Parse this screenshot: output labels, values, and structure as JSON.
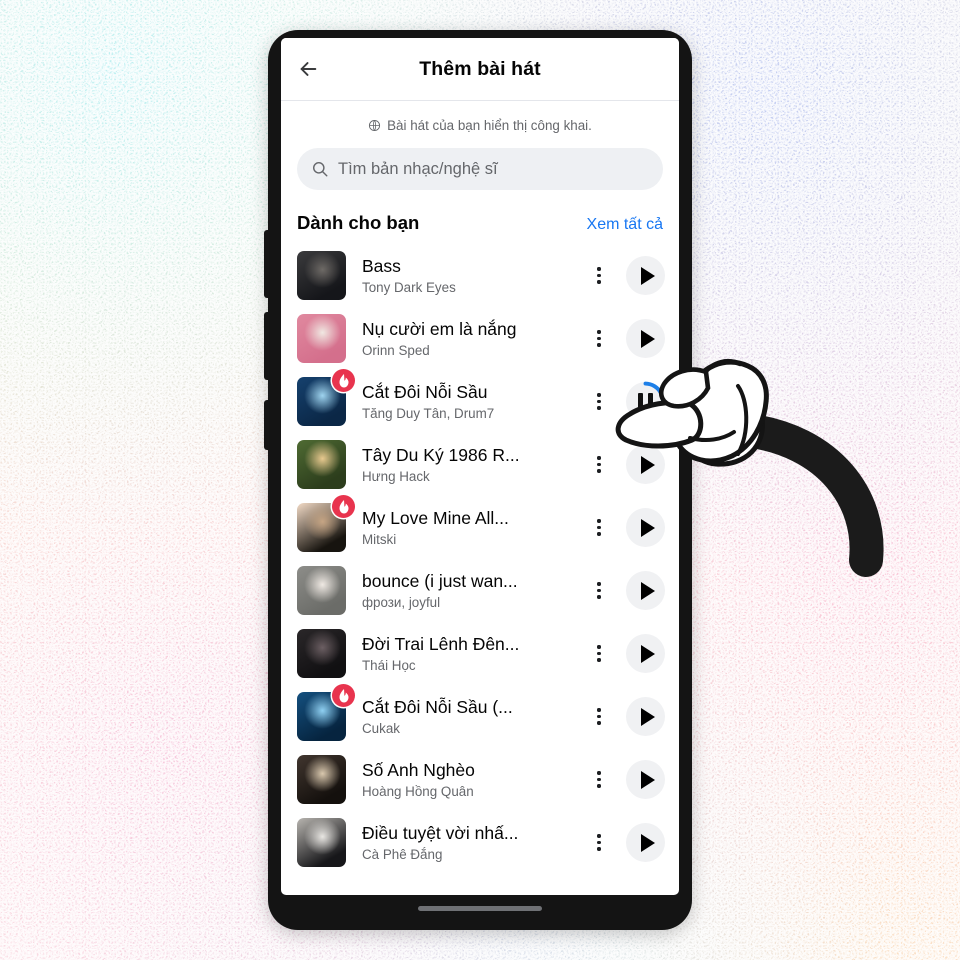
{
  "app": {
    "header": {
      "title": "Thêm bài hát",
      "back_icon": "back-arrow-icon"
    },
    "privacy_notice": {
      "icon": "globe-icon",
      "text": "Bài hát của bạn hiển thị công khai."
    },
    "search": {
      "icon": "search-icon",
      "placeholder": "Tìm bản nhạc/nghệ sĩ",
      "value": ""
    },
    "section": {
      "title": "Dành cho bạn",
      "see_all_label": "Xem tất cả"
    },
    "row_icons": {
      "kebab": "more-options-icon",
      "play": "play-icon",
      "pause": "pause-icon",
      "badge": "fire-trending-icon"
    },
    "songs": [
      {
        "title": "Bass",
        "artist": "Tony Dark Eyes",
        "state": "idle",
        "trending": false,
        "art": {
          "c1": "#3b3b3d",
          "c2": "#15161a",
          "c3": "#6e6a66"
        }
      },
      {
        "title": "Nụ cười em là nắng",
        "artist": "Orinn Sped",
        "state": "idle",
        "trending": false,
        "art": {
          "c1": "#e0899f",
          "c2": "#d46f8c",
          "c3": "#f0e8e2"
        }
      },
      {
        "title": "Cắt Đôi Nỗi Sầu",
        "artist": "Tăng Duy Tân, Drum7",
        "state": "playing",
        "trending": true,
        "art": {
          "c1": "#15416e",
          "c2": "#0b2746",
          "c3": "#9fd4ef"
        }
      },
      {
        "title": "Tây Du Ký 1986 R...",
        "artist": "Hưng Hack",
        "state": "idle",
        "trending": false,
        "art": {
          "c1": "#4f6b33",
          "c2": "#2c3d1c",
          "c3": "#e8c98f"
        }
      },
      {
        "title": "My Love Mine All...",
        "artist": "Mitski",
        "state": "idle",
        "trending": true,
        "art": {
          "c1": "#f3dbc6",
          "c2": "#17140f",
          "c3": "#c6a584"
        }
      },
      {
        "title": "bounce (i just wan...",
        "artist": "фрози, joyful",
        "state": "idle",
        "trending": false,
        "art": {
          "c1": "#8d8d89",
          "c2": "#6b6c68",
          "c3": "#efe9e3"
        }
      },
      {
        "title": "Đời Trai Lênh Đên...",
        "artist": "Thái Học",
        "state": "idle",
        "trending": false,
        "art": {
          "c1": "#2a2729",
          "c2": "#111012",
          "c3": "#6c5f63"
        }
      },
      {
        "title": "Cắt Đôi Nỗi Sầu (...",
        "artist": "Cukak",
        "state": "idle",
        "trending": true,
        "art": {
          "c1": "#14507f",
          "c2": "#06243f",
          "c3": "#8fd0f2"
        }
      },
      {
        "title": "Số Anh Nghèo",
        "artist": "Hoàng Hồng Quân",
        "state": "idle",
        "trending": false,
        "art": {
          "c1": "#41362f",
          "c2": "#14100d",
          "c3": "#d9c8ae"
        }
      },
      {
        "title": "Điều tuyệt vời nhấ...",
        "artist": "Cà Phê Đắng",
        "state": "idle",
        "trending": false,
        "art": {
          "c1": "#b8b5b0",
          "c2": "#17171a",
          "c3": "#e9e7e3"
        }
      }
    ]
  },
  "device": {
    "gesture_bar": "home-gesture-bar",
    "buttons": [
      "volume-up-button",
      "volume-down-button",
      "power-button"
    ]
  },
  "overlay": {
    "cursor": "pointing-hand-cursor"
  },
  "colors": {
    "accent_link": "#1877F2",
    "progress_arc": "#1d7fe8",
    "badge_red": "#E8344E",
    "text_primary": "#050505",
    "text_secondary": "#65676B",
    "search_bg": "#EEF0F3",
    "play_bg": "#F0F1F3",
    "device_frame": "#141414"
  }
}
